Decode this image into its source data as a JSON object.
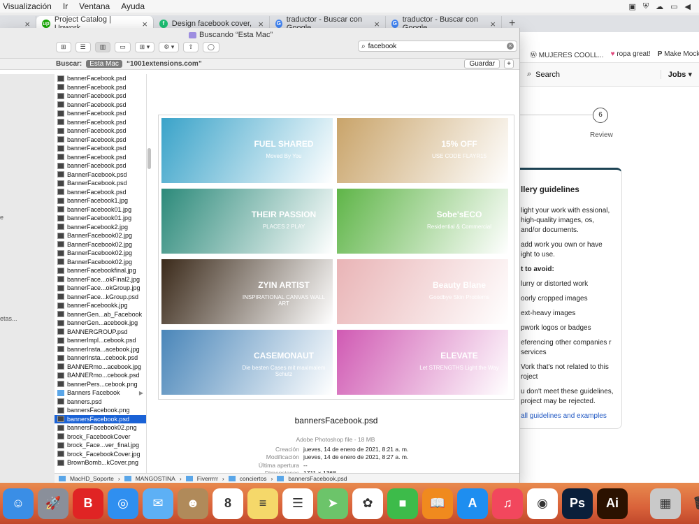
{
  "menubar": {
    "items": [
      "Visualización",
      "Ir",
      "Ventana",
      "Ayuda"
    ]
  },
  "browser": {
    "tabs": [
      {
        "label": "Project Catalog | Upwork",
        "active": true
      },
      {
        "label": "Design facebook cover, youtub",
        "active": false
      },
      {
        "label": "traductor - Buscar con Google",
        "active": false
      },
      {
        "label": "traductor - Buscar con Google",
        "active": false
      }
    ],
    "new_tab": "+",
    "bookmarks": [
      "MUJERES COOLL...",
      "ropa great!",
      "Make Mocku"
    ]
  },
  "finder": {
    "title": "Buscando “Esta Mac”",
    "search_value": "facebook",
    "scope_label": "Buscar:",
    "scope_tag": "Esta Mac",
    "scope_option": "“1001extensions.com”",
    "save_label": "Guardar",
    "add_label": "+",
    "files": [
      {
        "name": "bannerFacebook.psd"
      },
      {
        "name": "bannerFacebook.psd"
      },
      {
        "name": "bannerFacebook.psd"
      },
      {
        "name": "bannerFacebook.psd"
      },
      {
        "name": "bannerFacebook.psd"
      },
      {
        "name": "bannerFacebook.psd"
      },
      {
        "name": "bannerFacebook.psd"
      },
      {
        "name": "bannerFacebook.psd"
      },
      {
        "name": "bannerFacebook.psd"
      },
      {
        "name": "bannerFacebook.psd"
      },
      {
        "name": "bannerFacebook.psd"
      },
      {
        "name": "BannerFacebook.psd"
      },
      {
        "name": "BannerFacebook.psd"
      },
      {
        "name": "bannerFacebook.psd"
      },
      {
        "name": "bannerFacebook1.jpg"
      },
      {
        "name": "bannerFacebook01.jpg"
      },
      {
        "name": "bannerFacebook01.jpg"
      },
      {
        "name": "bannerFacebook2.jpg"
      },
      {
        "name": "BannerFacebook02.jpg"
      },
      {
        "name": "BannerFacebook02.jpg"
      },
      {
        "name": "BannerFacebook02.jpg"
      },
      {
        "name": "BannerFacebook02.jpg"
      },
      {
        "name": "bannerFacebookfinal.jpg"
      },
      {
        "name": "bannerFace...okFinal2.jpg"
      },
      {
        "name": "bannerFace...okGroup.jpg"
      },
      {
        "name": "bannerFace...kGroup.psd"
      },
      {
        "name": "bannerFacebookk.jpg"
      },
      {
        "name": "bannerGen...ab_Facebook"
      },
      {
        "name": "bannerGen...acebook.jpg"
      },
      {
        "name": "BANNERGROUP.psd"
      },
      {
        "name": "bannerImpl...cebook.psd"
      },
      {
        "name": "bannerInsta...acebook.jpg"
      },
      {
        "name": "bannerInsta...cebook.psd"
      },
      {
        "name": "BANNERmo...acebook.jpg"
      },
      {
        "name": "BANNERmo...cebook.psd"
      },
      {
        "name": "bannerPers...cebook.png"
      },
      {
        "name": "Banners Facebook",
        "folder": true
      },
      {
        "name": "banners.psd"
      },
      {
        "name": "bannersFacebook.png"
      },
      {
        "name": "bannersFacebook.psd",
        "selected": true
      },
      {
        "name": "bannersFacebook02.png"
      },
      {
        "name": "brock_FacebookCover"
      },
      {
        "name": "brock_Face...ver_final.jpg"
      },
      {
        "name": "brock_FacebookCover.jpg"
      },
      {
        "name": "BrownBomb...kCover.png"
      }
    ],
    "left_labels": [
      "e",
      "etas..."
    ],
    "preview": {
      "thumbs": [
        {
          "text": "FUEL SHARED",
          "sub": "Moved By You",
          "bg": "#3aa3c9"
        },
        {
          "text": "15% OFF",
          "sub": "USE CODE FLAYR15",
          "bg": "#c9a46a"
        },
        {
          "text": "THEIR PASSION",
          "sub": "PLACES 2 PLAY",
          "bg": "#2c8a7a"
        },
        {
          "text": "Sobe'sECO",
          "sub": "Residential & Commercial",
          "bg": "#5fb548"
        },
        {
          "text": "ZYIN ARTIST",
          "sub": "INSPIRATIONAL CANVAS WALL ART",
          "bg": "#3b2a1a"
        },
        {
          "text": "Beauty Blane",
          "sub": "Goodbye Skin Problems",
          "bg": "#e9b4b6"
        },
        {
          "text": "CASEMONAUT",
          "sub": "Die besten Cases mit maximalem Schutz",
          "bg": "#4a86b9"
        },
        {
          "text": "ELEVATE",
          "sub": "Let STRENGTHS Light the Way",
          "bg": "#d05ab3"
        }
      ],
      "filename": "bannersFacebook.psd",
      "kind": "Adobe Photoshop file - 18 MB",
      "info": [
        {
          "k": "Creación",
          "v": "jueves, 14 de enero de 2021, 8:21 a. m."
        },
        {
          "k": "Modificación",
          "v": "jueves, 14 de enero de 2021, 8:27 a. m."
        },
        {
          "k": "Última apertura",
          "v": "--"
        },
        {
          "k": "Dimensiones",
          "v": "1711 × 1368"
        }
      ],
      "tags_link": "Agregar etiquetas..."
    },
    "path": [
      "MacHD_Soporte",
      "MANGOSTINA",
      "Fiverrrrr",
      "conciertos",
      "bannersFacebook.psd"
    ]
  },
  "upwork": {
    "search_placeholder": "Search",
    "jobs_label": "Jobs",
    "step_number": "6",
    "step_label": "Review",
    "guidelines_title": "llery guidelines",
    "lines": [
      "light your work with essional, high-quality images, os, and/or documents.",
      "add work you own or have ight to use."
    ],
    "avoid_title": "t to avoid:",
    "avoid": [
      "lurry or distorted work",
      "oorly cropped images",
      "ext-heavy images",
      "pwork logos or badges",
      "eferencing other companies r services",
      "Vork that's not related to this roject"
    ],
    "warning": "u don't meet these guidelines, project may be rejected.",
    "link": "all guidelines and examples"
  },
  "dock": {
    "icons": [
      {
        "name": "finder-icon",
        "glyph": "☺",
        "bg": "#3a8ee6"
      },
      {
        "name": "launchpad-icon",
        "glyph": "🚀",
        "bg": "#8a8f9a"
      },
      {
        "name": "bitdefender-icon",
        "glyph": "B",
        "bg": "#e02424"
      },
      {
        "name": "safari-icon",
        "glyph": "◎",
        "bg": "#2f8ff0"
      },
      {
        "name": "mail-icon",
        "glyph": "✉",
        "bg": "#5db0f5"
      },
      {
        "name": "contacts-icon",
        "glyph": "☻",
        "bg": "#b08a5a"
      },
      {
        "name": "calendar-icon",
        "glyph": "8",
        "bg": "#ffffff"
      },
      {
        "name": "notes-icon",
        "glyph": "≡",
        "bg": "#f5d86a"
      },
      {
        "name": "reminders-icon",
        "glyph": "☰",
        "bg": "#ffffff"
      },
      {
        "name": "maps-icon",
        "glyph": "➤",
        "bg": "#6cc46a"
      },
      {
        "name": "photos-icon",
        "glyph": "✿",
        "bg": "#ffffff"
      },
      {
        "name": "facetime-icon",
        "glyph": "■",
        "bg": "#3dbb4a"
      },
      {
        "name": "books-icon",
        "glyph": "📖",
        "bg": "#f08a1e"
      },
      {
        "name": "appstore-icon",
        "glyph": "A",
        "bg": "#1e8ef0"
      },
      {
        "name": "music-icon",
        "glyph": "♫",
        "bg": "#f2475d"
      },
      {
        "name": "chrome-icon",
        "glyph": "◉",
        "bg": "#ffffff"
      },
      {
        "name": "photoshop-icon",
        "glyph": "Ps",
        "bg": "#0a1f3a"
      },
      {
        "name": "illustrator-icon",
        "glyph": "Ai",
        "bg": "#2b1200"
      },
      {
        "name": "downloads-stack-icon",
        "glyph": "▦",
        "bg": "#c9c9c9"
      },
      {
        "name": "trash-icon",
        "glyph": "🗑",
        "bg": "transparent"
      }
    ]
  }
}
